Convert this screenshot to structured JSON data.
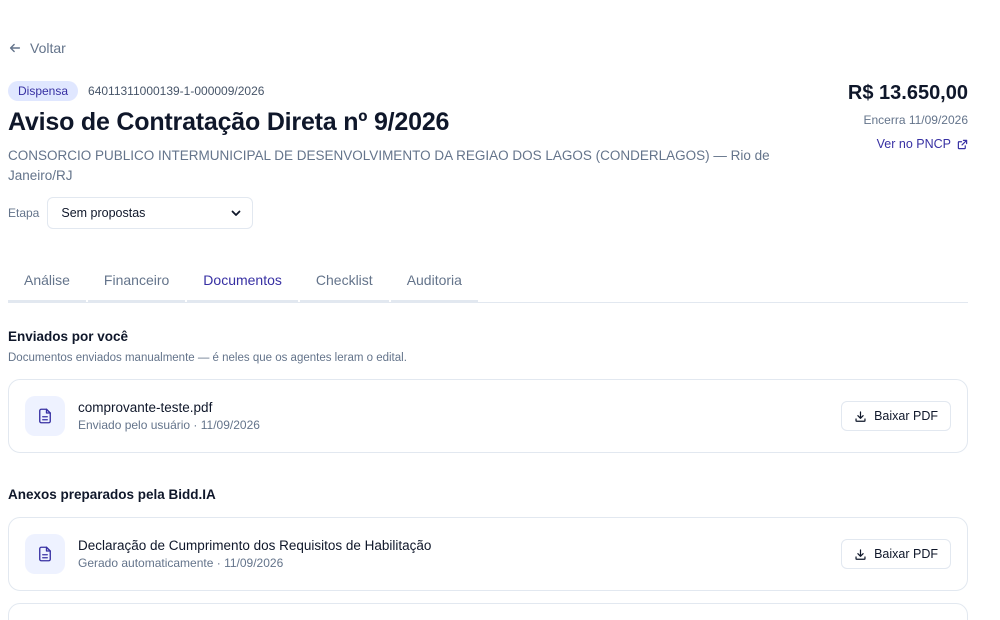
{
  "nav": {
    "back_label": "Voltar"
  },
  "header": {
    "badge": "Dispensa",
    "process_id": "64011311000139-1-000009/2026",
    "title": "Aviso de Contratação Direta nº 9/2026",
    "organization": "CONSORCIO PUBLICO INTERMUNICIPAL DE DESENVOLVIMENTO DA REGIAO DOS LAGOS (CONDERLAGOS) — Rio de Janeiro/RJ",
    "etapa_label": "Etapa",
    "etapa_value": "Sem propostas",
    "price": "R$ 13.650,00",
    "encerra": "Encerra 11/09/2026",
    "pncp_link": "Ver no PNCP"
  },
  "tabs": [
    {
      "label": "Análise",
      "active": false
    },
    {
      "label": "Financeiro",
      "active": false
    },
    {
      "label": "Documentos",
      "active": true
    },
    {
      "label": "Checklist",
      "active": false
    },
    {
      "label": "Auditoria",
      "active": false
    }
  ],
  "sent": {
    "title": "Enviados por você",
    "subtitle": "Documentos enviados manualmente — é neles que os agentes leram o edital.",
    "items": [
      {
        "name": "comprovante-teste.pdf",
        "sub": "Enviado pelo usuário · 11/09/2026",
        "button": "Baixar PDF"
      }
    ]
  },
  "annexes": {
    "title": "Anexos preparados pela Bidd.IA",
    "items": [
      {
        "name": "Declaração de Cumprimento dos Requisitos de Habilitação",
        "sub": "Gerado automaticamente · 11/09/2026",
        "button": "Baixar PDF"
      }
    ]
  },
  "colors": {
    "accent": "#3730a3",
    "badge_bg": "#e0e7ff",
    "icon_bg": "#eef2ff",
    "muted": "#64748b",
    "border": "#e2e8f0"
  },
  "icons": {
    "back": "arrow-left-icon",
    "select": "chevron-down-icon",
    "external": "external-link-icon",
    "document": "file-text-icon",
    "download": "download-icon"
  }
}
